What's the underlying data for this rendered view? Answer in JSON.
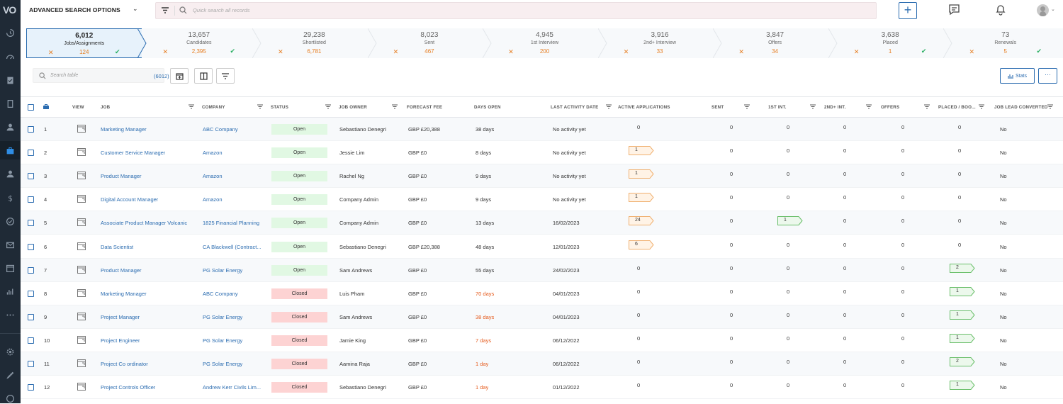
{
  "app": {
    "logo": "VO"
  },
  "topbar": {
    "advanced_search": "ADVANCED SEARCH OPTIONS",
    "quick_search_placeholder": "Quick search all records",
    "add_label": "+"
  },
  "pipeline": [
    {
      "count": "6,012",
      "label": "Jobs/Assignments",
      "num": "124",
      "active": true,
      "check": true
    },
    {
      "count": "13,657",
      "label": "Candidates",
      "num": "2,395",
      "check": true
    },
    {
      "count": "29,238",
      "label": "Shortlisted",
      "num": "6,781",
      "check": false
    },
    {
      "count": "8,023",
      "label": "Sent",
      "num": "467",
      "check": false
    },
    {
      "count": "4,945",
      "label": "1st Interview",
      "num": "200",
      "check": false
    },
    {
      "count": "3,916",
      "label": "2nd+ Interview",
      "num": "33",
      "check": false
    },
    {
      "count": "3,847",
      "label": "Offers",
      "num": "34",
      "check": false
    },
    {
      "count": "3,638",
      "label": "Placed",
      "num": "1",
      "check": true
    },
    {
      "count": "73",
      "label": "Renewals",
      "num": "5",
      "check": true
    }
  ],
  "toolbar": {
    "search_placeholder": "Search table",
    "count": "(6012)",
    "stats_label": "Stats",
    "more_label": "···"
  },
  "columns": {
    "view": "VIEW",
    "job": "JOB",
    "company": "COMPANY",
    "status": "STATUS",
    "job_owner": "JOB OWNER",
    "forecast_fee": "FORECAST FEE",
    "days_open": "DAYS OPEN",
    "last_activity": "LAST ACTIVITY DATE",
    "active_apps": "ACTIVE APPLICATIONS",
    "sent": "SENT",
    "first_int": "1ST INT.",
    "second_int": "2ND+ INT.",
    "offers": "OFFERS",
    "placed": "PLACED / BOO...",
    "lead_converted": "JOB LEAD CONVERTED"
  },
  "rows": [
    {
      "num": "1",
      "job": "Marketing Manager",
      "company": "ABC Company",
      "status": "Open",
      "owner": "Sebastiano Denegri",
      "fee": "GBP £20,388",
      "days": "38 days",
      "days_red": false,
      "last": "No activity yet",
      "apps": "0",
      "apps_tag": false,
      "sent": "0",
      "int1": "0",
      "int1_tag": false,
      "int2": "0",
      "offers": "0",
      "placed": "0",
      "placed_tag": false,
      "lead": "No"
    },
    {
      "num": "2",
      "job": "Customer Service Manager",
      "company": "Amazon",
      "status": "Open",
      "owner": "Jessie Lim",
      "fee": "GBP £0",
      "days": "8 days",
      "days_red": false,
      "last": "No activity yet",
      "apps": "1",
      "apps_tag": true,
      "sent": "0",
      "int1": "0",
      "int1_tag": false,
      "int2": "0",
      "offers": "0",
      "placed": "0",
      "placed_tag": false,
      "lead": "No"
    },
    {
      "num": "3",
      "job": "Product Manager",
      "company": "Amazon",
      "status": "Open",
      "owner": "Rachel Ng",
      "fee": "GBP £0",
      "days": "9 days",
      "days_red": false,
      "last": "No activity yet",
      "apps": "1",
      "apps_tag": true,
      "sent": "0",
      "int1": "0",
      "int1_tag": false,
      "int2": "0",
      "offers": "0",
      "placed": "0",
      "placed_tag": false,
      "lead": "No"
    },
    {
      "num": "4",
      "job": "Digital Account Manager",
      "company": "Amazon",
      "status": "Open",
      "owner": "Company Admin",
      "fee": "GBP £0",
      "days": "9 days",
      "days_red": false,
      "last": "No activity yet",
      "apps": "1",
      "apps_tag": true,
      "sent": "0",
      "int1": "0",
      "int1_tag": false,
      "int2": "0",
      "offers": "0",
      "placed": "0",
      "placed_tag": false,
      "lead": "No"
    },
    {
      "num": "5",
      "job": "Associate Product Manager Volcanic",
      "company": "1825 Financial Planning",
      "status": "Open",
      "owner": "Company Admin",
      "fee": "GBP £0",
      "days": "13 days",
      "days_red": false,
      "last": "16/02/2023",
      "apps": "24",
      "apps_tag": true,
      "sent": "0",
      "int1": "1",
      "int1_tag": true,
      "int2": "0",
      "offers": "0",
      "placed": "0",
      "placed_tag": false,
      "lead": "No"
    },
    {
      "num": "6",
      "job": "Data Scientist",
      "company": "CA Blackwell (Contract...",
      "status": "Open",
      "owner": "Sebastiano Denegri",
      "fee": "GBP £20,388",
      "days": "48 days",
      "days_red": false,
      "last": "12/01/2023",
      "apps": "6",
      "apps_tag": true,
      "sent": "0",
      "int1": "0",
      "int1_tag": false,
      "int2": "0",
      "offers": "0",
      "placed": "0",
      "placed_tag": false,
      "lead": "No"
    },
    {
      "num": "7",
      "job": "Product Manager",
      "company": "PG Solar Energy",
      "status": "Open",
      "owner": "Sam Andrews",
      "fee": "GBP £0",
      "days": "55 days",
      "days_red": false,
      "last": "24/02/2023",
      "apps": "0",
      "apps_tag": false,
      "sent": "0",
      "int1": "0",
      "int1_tag": false,
      "int2": "0",
      "offers": "0",
      "placed": "2",
      "placed_tag": true,
      "lead": "No"
    },
    {
      "num": "8",
      "job": "Marketing Manager",
      "company": "ABC Company",
      "status": "Closed",
      "owner": "Luis Pham",
      "fee": "GBP £0",
      "days": "70 days",
      "days_red": true,
      "last": "04/01/2023",
      "apps": "0",
      "apps_tag": false,
      "sent": "0",
      "int1": "0",
      "int1_tag": false,
      "int2": "0",
      "offers": "0",
      "placed": "1",
      "placed_tag": true,
      "lead": "No"
    },
    {
      "num": "9",
      "job": "Project Manager",
      "company": "PG Solar Energy",
      "status": "Closed",
      "owner": "Sam Andrews",
      "fee": "GBP £0",
      "days": "38 days",
      "days_red": true,
      "last": "04/01/2023",
      "apps": "0",
      "apps_tag": false,
      "sent": "0",
      "int1": "0",
      "int1_tag": false,
      "int2": "0",
      "offers": "0",
      "placed": "1",
      "placed_tag": true,
      "lead": "No"
    },
    {
      "num": "10",
      "job": "Project Engineer",
      "company": "PG Solar Energy",
      "status": "Closed",
      "owner": "Jamie King",
      "fee": "GBP £0",
      "days": "7 days",
      "days_red": true,
      "last": "06/12/2022",
      "apps": "0",
      "apps_tag": false,
      "sent": "0",
      "int1": "0",
      "int1_tag": false,
      "int2": "0",
      "offers": "0",
      "placed": "1",
      "placed_tag": true,
      "lead": "No"
    },
    {
      "num": "11",
      "job": "Project Co ordinator",
      "company": "PG Solar Energy",
      "status": "Closed",
      "owner": "Aamina Raja",
      "fee": "GBP £0",
      "days": "1 day",
      "days_red": true,
      "last": "06/12/2022",
      "apps": "0",
      "apps_tag": false,
      "sent": "0",
      "int1": "0",
      "int1_tag": false,
      "int2": "0",
      "offers": "0",
      "placed": "2",
      "placed_tag": true,
      "lead": "No"
    },
    {
      "num": "12",
      "job": "Project Controls Officer",
      "company": "Andrew Kerr Civils Lim...",
      "status": "Closed",
      "owner": "Sebastiano Denegri",
      "fee": "GBP £0",
      "days": "1 day",
      "days_red": true,
      "last": "01/12/2022",
      "apps": "0",
      "apps_tag": false,
      "sent": "0",
      "int1": "0",
      "int1_tag": false,
      "int2": "0",
      "offers": "0",
      "placed": "1",
      "placed_tag": true,
      "lead": "No"
    }
  ],
  "colors": {
    "accent": "#2b6cb0",
    "sidebar": "#1f2a36",
    "open_bg": "#e1f8e3",
    "closed_bg": "#fdd3d3",
    "orange": "#e67e22",
    "green": "#27ae60"
  }
}
